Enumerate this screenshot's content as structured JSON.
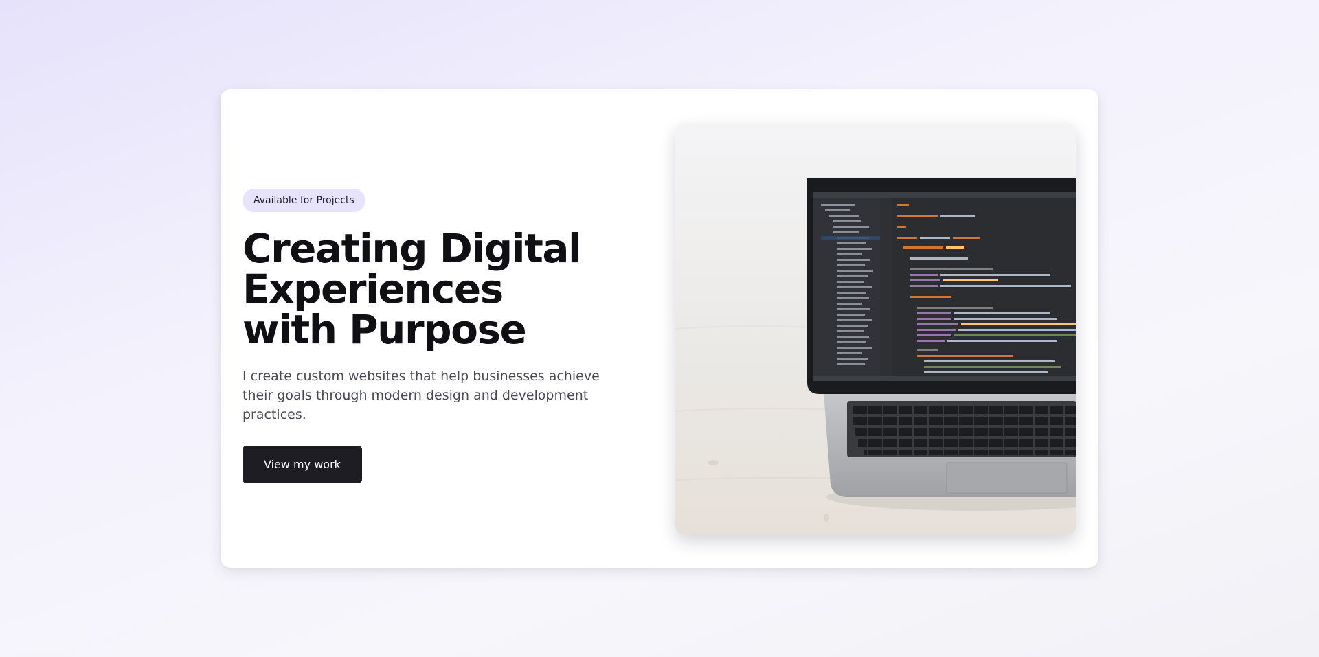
{
  "hero": {
    "badge": "Available for Projects",
    "title_lines": [
      "Creating Digital",
      "Experiences",
      "with Purpose"
    ],
    "description": "I create custom websites that help businesses achieve their goals through modern design and development practices.",
    "cta_label": "View my work",
    "image": {
      "subject": "laptop-with-code-editor",
      "description": "Laptop on a wooden desk showing a code editor"
    }
  },
  "colors": {
    "background": "#efedfb",
    "card": "#ffffff",
    "badge_bg": "#e7e3fb",
    "cta_bg": "#1e1d24",
    "title": "#0f0f14",
    "body_text": "#4a4a55"
  }
}
